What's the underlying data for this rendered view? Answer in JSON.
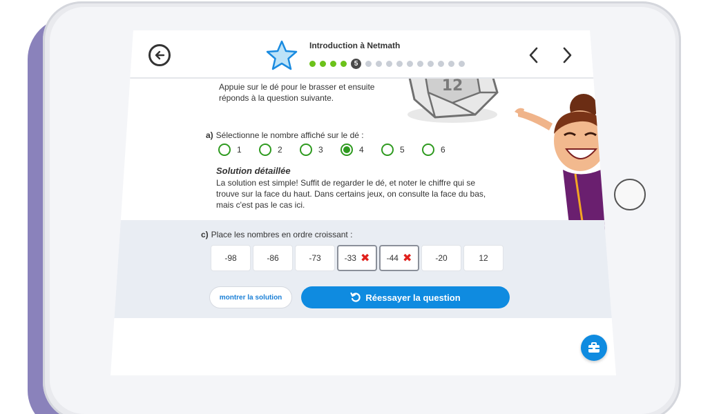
{
  "header": {
    "lesson_title": "Introduction à Netmath",
    "progress": {
      "done_count": 4,
      "current_step": "5",
      "remaining_count": 10
    }
  },
  "exercise": {
    "intro": "Appuie sur le dé pour le brasser et ensuite réponds à la question suivante.",
    "question_a": {
      "letter": "a)",
      "text": "Sélectionne le nombre affiché sur le dé :",
      "options": [
        "1",
        "2",
        "3",
        "4",
        "5",
        "6"
      ],
      "selected": "4"
    },
    "solution": {
      "title": "Solution détaillée",
      "text": "La solution est simple! Suffit de regarder le dé, et noter le chiffre qui se trouve sur la face du haut. Dans certains jeux, on consulte la face du bas, mais c'est pas le cas ici."
    },
    "question_c": {
      "letter": "c)",
      "text": "Place les nombres en ordre croissant :",
      "tiles": [
        "-98",
        "-86",
        "-73",
        "-33",
        "-44",
        "-20",
        "12"
      ],
      "wrong_tiles": [
        "-33",
        "-44"
      ]
    },
    "buttons": {
      "show_solution": "montrer la solution",
      "retry": "Réessayer la question"
    }
  },
  "die_face": "12",
  "colors": {
    "accent_blue": "#0f8be0",
    "success_green": "#6cc21a",
    "radio_green": "#2e9a1f",
    "error_red": "#e0201c",
    "panel_bg": "#e9edf3",
    "tablet_shadow": "#8a82bb"
  },
  "icons": [
    "back-arrow-icon",
    "star-icon",
    "chevron-left-icon",
    "chevron-right-icon",
    "retry-icon",
    "toolbox-icon",
    "x-mark-icon"
  ]
}
